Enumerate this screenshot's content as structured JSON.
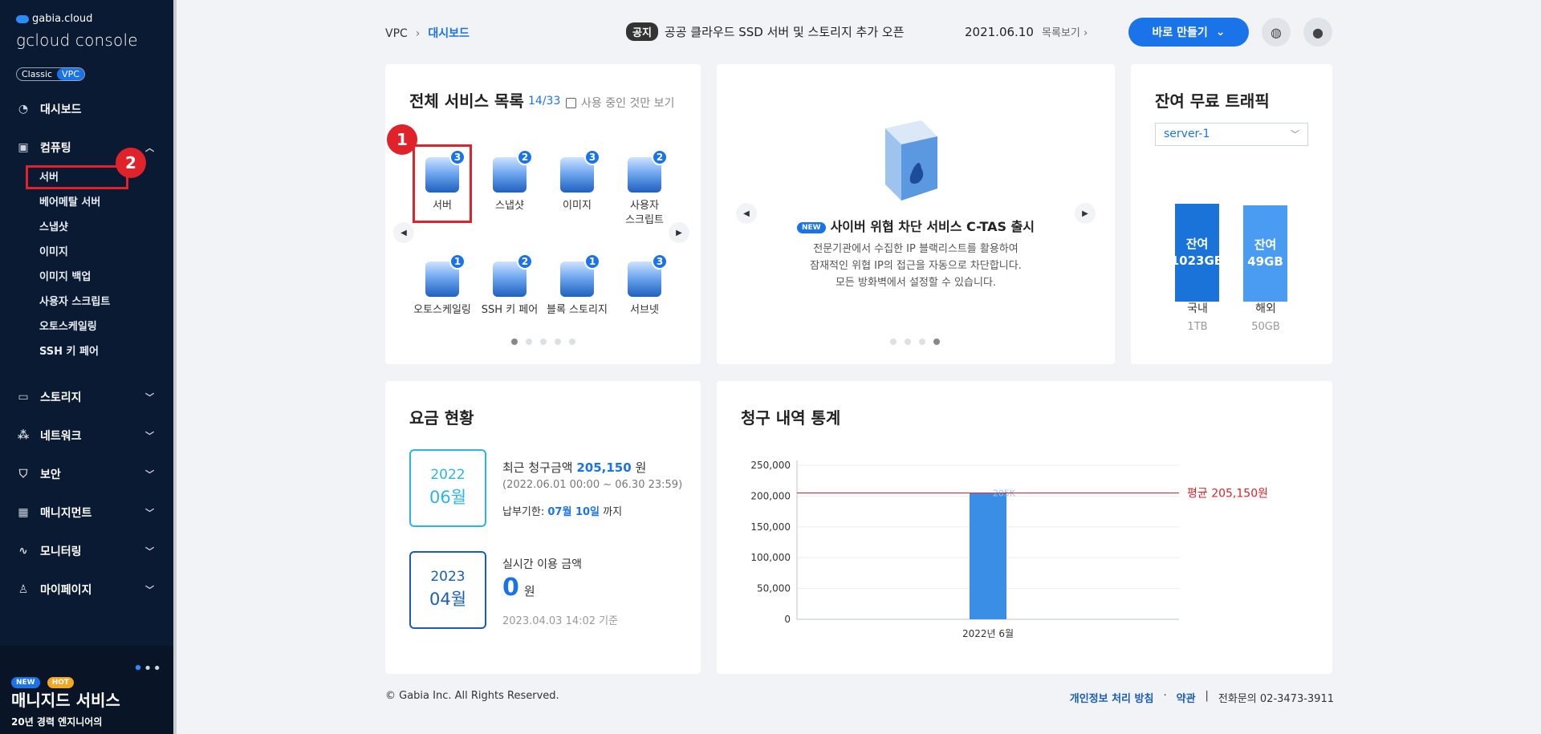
{
  "sidebar": {
    "brand_small": "gabia.cloud",
    "brand_big": "gcloud console",
    "toggle": {
      "classic": "Classic",
      "vpc": "VPC"
    },
    "dashboard": "대시보드",
    "computing": "컴퓨팅",
    "computing_items": [
      "서버",
      "베어메탈 서버",
      "스냅샷",
      "이미지",
      "이미지 백업",
      "사용자 스크립트",
      "오토스케일링",
      "SSH 키 페어"
    ],
    "sections": [
      "스토리지",
      "네트워크",
      "보안",
      "매니지먼트",
      "모니터링",
      "마이페이지"
    ],
    "promo": {
      "badge_new": "NEW",
      "badge_hot": "HOT",
      "title": "매니지드 서비스",
      "desc": "20년 경력 엔지니어의"
    }
  },
  "markers": {
    "one": "1",
    "two": "2"
  },
  "topbar": {
    "breadcrumb_root": "VPC",
    "breadcrumb_current": "대시보드",
    "notice_tag": "공지",
    "notice_text": "공공 클라우드 SSD 서버 및 스토리지 추가 오픈",
    "notice_date": "2021.06.10",
    "notice_more": "목록보기",
    "make_button": "바로 만들기"
  },
  "services_card": {
    "title": "전체 서비스 목록",
    "count": "14/33",
    "only_in_use": "사용 중인 것만 보기",
    "items": [
      {
        "label": "서버",
        "num": "3"
      },
      {
        "label": "스냅샷",
        "num": "2"
      },
      {
        "label": "이미지",
        "num": "3"
      },
      {
        "label": "사용자 스크립트",
        "num": "2"
      },
      {
        "label": "오토스케일링",
        "num": "1"
      },
      {
        "label": "SSH 키 페어",
        "num": "2"
      },
      {
        "label": "블록 스토리지",
        "num": "1"
      },
      {
        "label": "서브넷",
        "num": "3"
      }
    ],
    "page_active": 1,
    "page_count": 5
  },
  "news_card": {
    "badge": "NEW",
    "title": "사이버 위협 차단 서비스 C-TAS 출시",
    "body": [
      "전문기관에서 수집한 IP 블랙리스트를 활용하여",
      "잠재적인 위협 IP의 접근을 자동으로 차단합니다.",
      "모든 방화벽에서 설정할 수 있습니다."
    ],
    "page_active": 4,
    "page_count": 4
  },
  "traffic_card": {
    "title": "잔여 무료 트래픽",
    "select_value": "server-1",
    "bars": [
      {
        "line1": "잔여",
        "line2": "1023GB",
        "label": "국내",
        "total": "1TB",
        "fill_ratio": 1.0,
        "color": "#1a73d9"
      },
      {
        "line1": "잔여",
        "line2": "49GB",
        "label": "해외",
        "total": "50GB",
        "fill_ratio": 0.98,
        "color": "#4a9cf3"
      }
    ]
  },
  "billing_card": {
    "title": "요금 현황",
    "recent": {
      "year": "2022",
      "month": "06월",
      "label": "최근 청구금액",
      "amount": "205,150",
      "unit": "원",
      "period": "(2022.06.01 00:00 ~ 06.30 23:59)",
      "due_label": "납부기한:",
      "due_date": "07월 10일",
      "due_suffix": "까지"
    },
    "realtime": {
      "year": "2023",
      "month": "04월",
      "label": "실시간 이용 금액",
      "amount": "0",
      "unit": "원",
      "basis": "2023.04.03 14:02 기준"
    }
  },
  "stats_card": {
    "title": "청구 내역 통계"
  },
  "chart_data": {
    "type": "bar",
    "categories": [
      "2022년 6월"
    ],
    "values": [
      205150
    ],
    "ylim": [
      0,
      250000
    ],
    "yticks": [
      "250,000",
      "200,000",
      "150,000",
      "100,000",
      "50,000",
      "0"
    ],
    "bar_label": "205K",
    "average": {
      "value": 205150,
      "label": "평균 205,150원",
      "color": "#e0222a"
    },
    "bar_color": "#3b8ee6",
    "grid": true
  },
  "footer": {
    "copyright": "© Gabia Inc. All Rights Reserved.",
    "privacy": "개인정보 처리 방침",
    "terms": "약관",
    "phone_label": "전화문의",
    "phone": "02-3473-3911"
  }
}
